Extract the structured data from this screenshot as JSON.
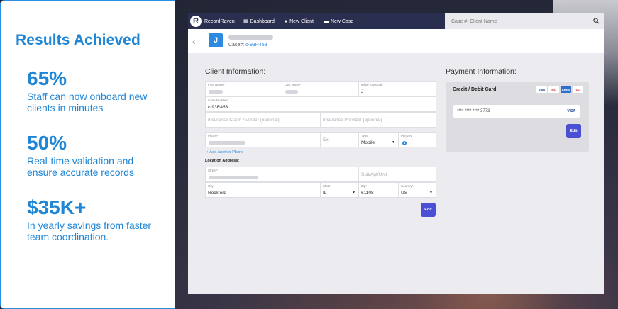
{
  "left": {
    "title": "Results Achieved",
    "stats": [
      {
        "value": "65%",
        "text": "Staff can now onboard new clients in minutes"
      },
      {
        "value": "50%",
        "text": "Real-time validation and ensure accurate records"
      },
      {
        "value": "$35K+",
        "text": "In yearly savings from faster team coordination."
      }
    ]
  },
  "app": {
    "logo": "RecordRaven",
    "logo_mark": "R",
    "nav": [
      {
        "label": "Dashboard",
        "icon": "grid-icon"
      },
      {
        "label": "New Client",
        "icon": "info-icon"
      },
      {
        "label": "New Case",
        "icon": "briefcase-icon"
      }
    ],
    "search_placeholder": "Case #, Client Name"
  },
  "case": {
    "avatar": "J",
    "case_label": "Case#:",
    "case_number": "c-93R453"
  },
  "client": {
    "title": "Client Information:",
    "first_name_label": "First Name*",
    "last_name_label": "Last Name*",
    "initial_label": "Initial (optional)",
    "initial_value": "J",
    "case_number_label": "Case Number*",
    "case_number_value": "c-93R453",
    "claim_placeholder": "Insurance Claim Number (optional)",
    "provider_placeholder": "Insurance Provider (optional)",
    "phone_label": "Phone*",
    "ext_placeholder": "Ext",
    "type_label": "Type",
    "type_value": "Mobile",
    "primary_label": "Primary",
    "add_phone": "+ Add Another Phone",
    "location_title": "Location Address:",
    "street_label": "Street*",
    "suite_placeholder": "Suit/Apt/Unit",
    "city_label": "City*",
    "city_value": "Rockford",
    "state_label": "State*",
    "state_value": "IL",
    "zip_label": "Zip*",
    "zip_value": "61108",
    "country_label": "Country*",
    "country_value": "US",
    "edit_label": "Edit"
  },
  "payment": {
    "title": "Payment Information:",
    "card_heading": "Credit / Debit Card",
    "brands": [
      "VISA",
      "MC",
      "AMEX",
      "DC"
    ],
    "card_number": "**** **** **** 3773",
    "card_brand": "VISA",
    "edit_label": "Edit"
  },
  "colors": {
    "accent": "#1f86d6",
    "nav_bg": "#2b2f4f",
    "button": "#4a4fd4"
  }
}
